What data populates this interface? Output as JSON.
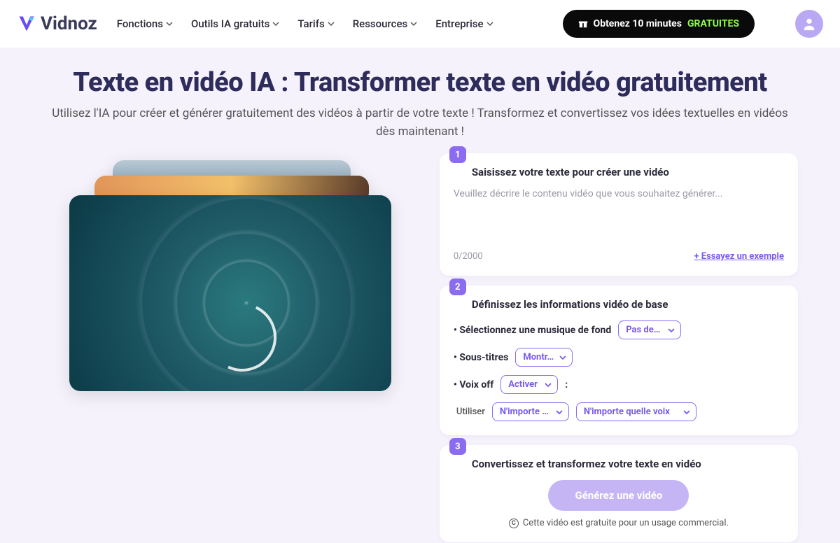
{
  "brand": "Vidnoz",
  "nav": {
    "items": [
      "Fonctions",
      "Outils IA gratuits",
      "Tarifs",
      "Ressources",
      "Entreprise"
    ]
  },
  "cta": {
    "prefix": "Obtenez 10 minutes",
    "highlight": "GRATUITES"
  },
  "hero": {
    "title": "Texte en vidéo IA : Transformer texte en vidéo gratuitement",
    "subtitle": "Utilisez l'IA pour créer et générer gratuitement des vidéos à partir de votre texte ! Transformez et convertissez vos idées textuelles en vidéos dès maintenant !"
  },
  "step1": {
    "num": "1",
    "title": "Saisissez votre texte pour créer une vidéo",
    "placeholder": "Veuillez décrire le contenu vidéo que vous souhaitez générer...",
    "counter": "0/2000",
    "example": "+ Essayez un exemple"
  },
  "step2": {
    "num": "2",
    "title": "Définissez les informations vidéo de base",
    "music_label": "Sélectionnez une musique de fond",
    "music_value": "Pas de m…",
    "subtitles_label": "Sous-titres",
    "subtitles_value": "Montr…",
    "voice_label": "Voix off",
    "voice_value": "Activer",
    "use_label": "Utiliser",
    "use_lang": "N'importe …",
    "use_voice": "N'importe quelle voix"
  },
  "step3": {
    "num": "3",
    "title": "Convertissez et transformez votre texte en vidéo",
    "button": "Générez une vidéo",
    "note": "Cette vidéo est gratuite pour un usage commercial."
  }
}
